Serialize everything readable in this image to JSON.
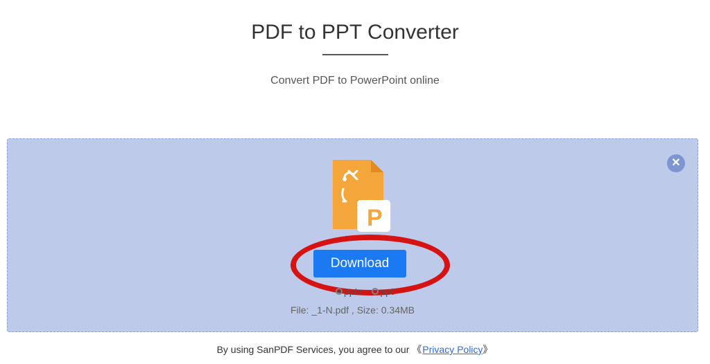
{
  "header": {
    "title": "PDF to PPT Converter",
    "subtitle": "Convert PDF to PowerPoint online"
  },
  "converter": {
    "download_label": "Download",
    "format_options": [
      {
        "label": "pptx",
        "selected": true
      },
      {
        "label": "ppt",
        "selected": false
      }
    ],
    "file_info_prefix": "File: ",
    "file_name": "_1-N.pdf",
    "file_info_size_prefix": " , Size: ",
    "file_size": "0.34MB"
  },
  "footer": {
    "text_prefix": "By using SanPDF Services, you agree to our ",
    "bracket_open": "《",
    "link_text": "Privacy Policy",
    "bracket_close": "》"
  },
  "icons": {
    "close": "✕"
  }
}
